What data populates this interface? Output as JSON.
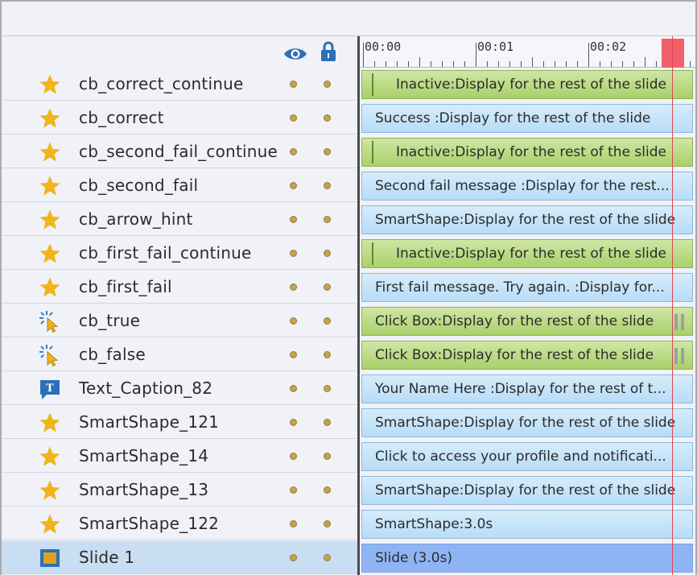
{
  "colors": {
    "star": "#f0b41c",
    "bar_blue": "#c6e4f9",
    "bar_green": "#b9db82",
    "bar_slide": "#8eb4f4",
    "playhead": "#e0454f",
    "selected_row": "#c9ddf3"
  },
  "header": {
    "visibility_icon": "eye-icon",
    "lock_icon": "lock-icon"
  },
  "ruler": {
    "labels": [
      "00:00",
      "00:01",
      "00:02"
    ]
  },
  "layers": [
    {
      "name": "cb_correct_continue",
      "icon": "star-icon",
      "bar": "Inactive:Display for the rest of the slide",
      "style": "green inactive"
    },
    {
      "name": "cb_correct",
      "icon": "star-icon",
      "bar": "Success :Display for the rest of the slide",
      "style": "blue"
    },
    {
      "name": "cb_second_fail_continue",
      "icon": "star-icon",
      "bar": "Inactive:Display for the rest of the slide",
      "style": "green inactive"
    },
    {
      "name": "cb_second_fail",
      "icon": "star-icon",
      "bar": "Second fail message :Display for the rest...",
      "style": "blue"
    },
    {
      "name": "cb_arrow_hint",
      "icon": "star-icon",
      "bar": "SmartShape:Display for the rest of the slide",
      "style": "blue"
    },
    {
      "name": "cb_first_fail_continue",
      "icon": "star-icon",
      "bar": "Inactive:Display for the rest of the slide",
      "style": "green inactive"
    },
    {
      "name": "cb_first_fail",
      "icon": "star-icon",
      "bar": "First fail message. Try again. :Display for...",
      "style": "blue"
    },
    {
      "name": "cb_true",
      "icon": "click-box-icon",
      "bar": "Click Box:Display for the rest of the slide",
      "style": "green handle"
    },
    {
      "name": "cb_false",
      "icon": "click-box-icon",
      "bar": "Click Box:Display for the rest of the slide",
      "style": "green handle"
    },
    {
      "name": "Text_Caption_82",
      "icon": "text-caption-icon",
      "bar": "Your Name Here :Display for the rest of t...",
      "style": "blue"
    },
    {
      "name": "SmartShape_121",
      "icon": "star-icon",
      "bar": "SmartShape:Display for the rest of the slide",
      "style": "blue"
    },
    {
      "name": "SmartShape_14",
      "icon": "star-icon",
      "bar": "Click to access your profile and notificati...",
      "style": "blue"
    },
    {
      "name": "SmartShape_13",
      "icon": "star-icon",
      "bar": "SmartShape:Display for the rest of the slide",
      "style": "blue"
    },
    {
      "name": "SmartShape_122",
      "icon": "star-icon",
      "bar": "SmartShape:3.0s",
      "style": "blue"
    },
    {
      "name": "Slide 1",
      "icon": "slide-icon",
      "bar": "Slide (3.0s)",
      "style": "slide selected"
    }
  ]
}
